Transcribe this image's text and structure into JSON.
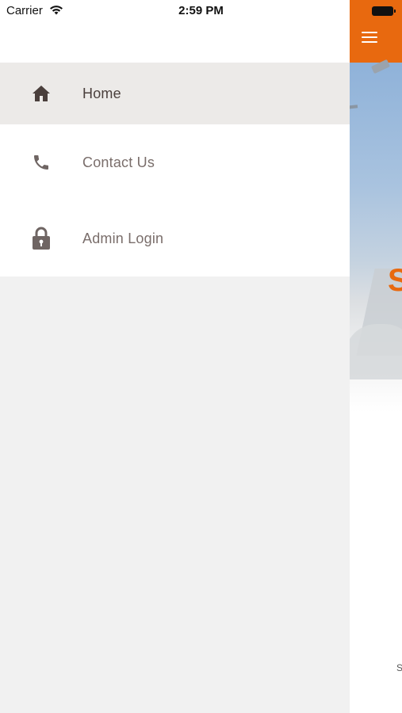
{
  "status_bar": {
    "carrier": "Carrier",
    "time": "2:59 PM"
  },
  "menu": {
    "items": [
      {
        "label": "Home",
        "icon": "home-icon",
        "active": true
      },
      {
        "label": "Contact Us",
        "icon": "phone-icon",
        "active": false
      },
      {
        "label": "Admin Login",
        "icon": "lock-icon",
        "active": false
      }
    ]
  },
  "colors": {
    "accent": "#e8690f",
    "active_row": "#eceae8",
    "icon": "#4a3f3c"
  }
}
